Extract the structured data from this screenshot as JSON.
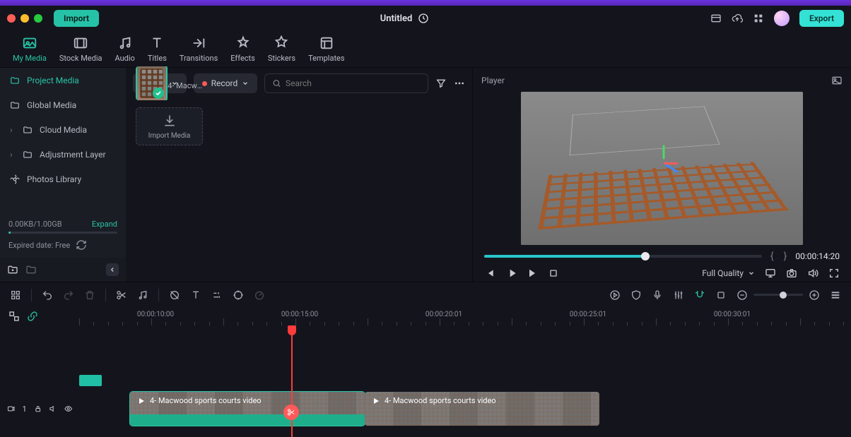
{
  "titlebar": {
    "import": "Import",
    "title": "Untitled",
    "export": "Export"
  },
  "topTabs": [
    {
      "id": "my-media",
      "label": "My Media",
      "active": true
    },
    {
      "id": "stock-media",
      "label": "Stock Media"
    },
    {
      "id": "audio",
      "label": "Audio"
    },
    {
      "id": "titles",
      "label": "Titles"
    },
    {
      "id": "transitions",
      "label": "Transitions"
    },
    {
      "id": "effects",
      "label": "Effects"
    },
    {
      "id": "stickers",
      "label": "Stickers"
    },
    {
      "id": "templates",
      "label": "Templates"
    }
  ],
  "sidebar": {
    "items": [
      {
        "id": "project-media",
        "label": "Project Media",
        "active": true,
        "icon": "folder"
      },
      {
        "id": "global-media",
        "label": "Global Media",
        "icon": "folder"
      },
      {
        "id": "cloud-media",
        "label": "Cloud Media",
        "icon": "folder",
        "expandable": true
      },
      {
        "id": "adjustment-layer",
        "label": "Adjustment Layer",
        "icon": "folder",
        "expandable": true
      },
      {
        "id": "photos-library",
        "label": "Photos Library",
        "icon": "flower"
      }
    ],
    "storage": {
      "used": "0.00KB",
      "total": "1.00GB",
      "sep": "/",
      "expand": "Expand"
    },
    "expired": {
      "label": "Expired date: Free"
    }
  },
  "mediabar": {
    "import": "Import",
    "record": "Record",
    "searchPlaceholder": "Search"
  },
  "mediaTiles": {
    "importLabel": "Import Media",
    "clip1": "4- Macwo…ourts video"
  },
  "player": {
    "title": "Player",
    "timecode": "00:00:14:20",
    "quality": "Full Quality"
  },
  "ruler": {
    "labels": [
      "00:00:10:00",
      "00:00:15:00",
      "00:00:20:01",
      "00:00:25:01",
      "00:00:30:01"
    ]
  },
  "trackHead": {
    "index": "1"
  },
  "clips": {
    "a": "4- Macwood sports courts video",
    "b": "4- Macwood sports courts video"
  }
}
